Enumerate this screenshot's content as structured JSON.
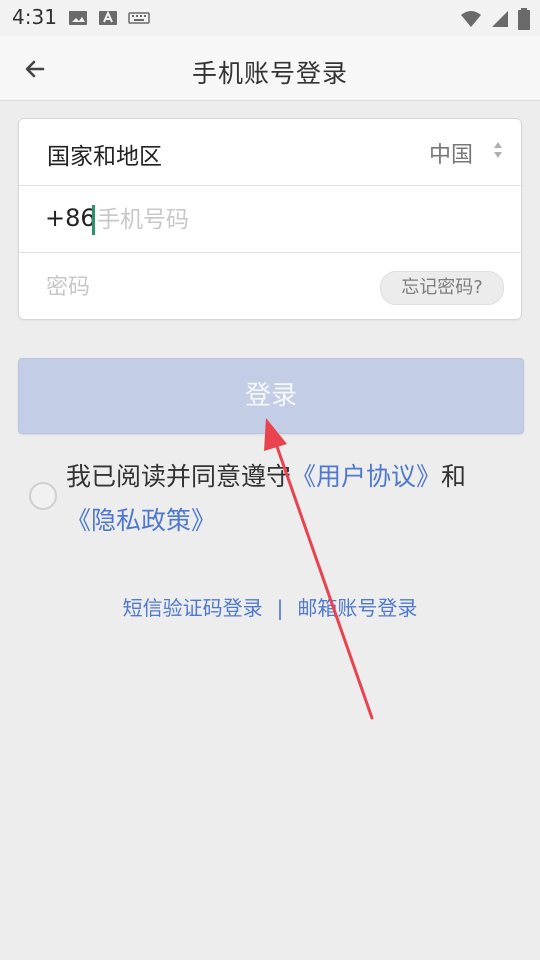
{
  "status_bar": {
    "time": "4:31",
    "left_icons": [
      "image-icon",
      "text-icon",
      "keyboard-icon"
    ],
    "right_icons": [
      "wifi-icon",
      "signal-icon",
      "battery-icon"
    ]
  },
  "header": {
    "title": "手机账号登录",
    "back_icon": "back-arrow-icon"
  },
  "form": {
    "country_label": "国家和地区",
    "country_value": "中国",
    "country_code": "+86",
    "phone_placeholder": "手机号码",
    "password_placeholder": "密码",
    "forgot_password_label": "忘记密码?"
  },
  "login_button_label": "登录",
  "agreement": {
    "prefix": "我已阅读并同意遵守",
    "user_agreement": "《用户协议》",
    "conjunction": "和",
    "privacy_policy": "《隐私政策》",
    "checked": false
  },
  "alternate_login": {
    "sms_login": "短信验证码登录",
    "separator": "|",
    "email_login": "邮箱账号登录"
  },
  "colors": {
    "background": "#ededed",
    "link": "#4f79cf",
    "login_button": "#c4cde6",
    "cursor": "#2f8f6f",
    "annotation_arrow": "#e8434f"
  }
}
